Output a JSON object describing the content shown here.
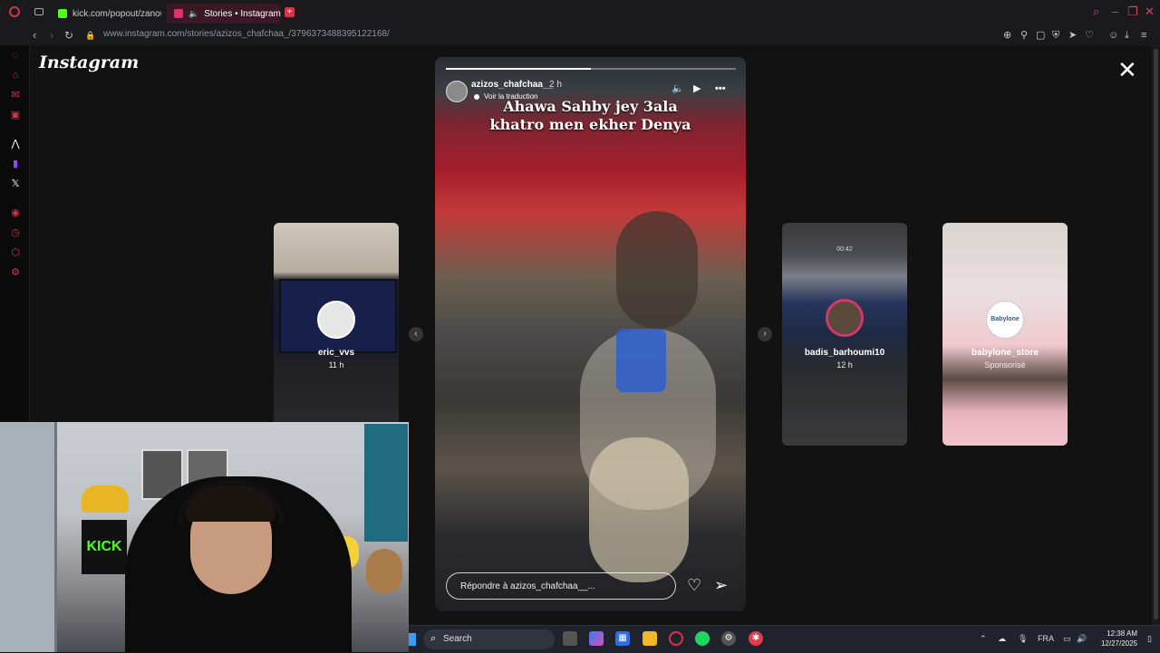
{
  "browser": {
    "tabs": [
      {
        "label": "kick.com/popout/zanoun",
        "icon": "kick-icon",
        "color": "#53fc18"
      },
      {
        "label": "Stories • Instagram",
        "icon": "instagram-icon",
        "color": "#e1306c"
      }
    ],
    "new_tab": "+",
    "url": "www.instagram.com/stories/azizos_chafchaa_/3796373488395122168/"
  },
  "instagram": {
    "logo": "Instagram",
    "close": "✕"
  },
  "story": {
    "username": "azizos_chafchaa__",
    "time": "2 h",
    "translate": "Voir la traduction",
    "caption_line1": "Ahawa Sahby jey 3ala",
    "caption_line2": "khatro men ekher Denya",
    "progress": 0.5,
    "reply_placeholder": "Répondre à azizos_chafchaa__...",
    "icons": {
      "mute": "speaker-icon",
      "play": "play-icon",
      "more": "more-icon",
      "like": "heart-icon",
      "send": "send-icon"
    }
  },
  "cards": [
    {
      "name": "eric_vvs",
      "sub": "11 h"
    },
    {
      "name": "badis_barhoumi10",
      "sub": "12 h",
      "overlay": "00:42"
    },
    {
      "name": "babylone_store",
      "sub": "Sponsorisé",
      "avatar_text": "Babylone"
    }
  ],
  "webcam": {
    "kick_text": "KICK"
  },
  "taskbar": {
    "search": "Search",
    "lang": "FRA",
    "time": "12:38 AM",
    "date": "12/27/2025"
  }
}
